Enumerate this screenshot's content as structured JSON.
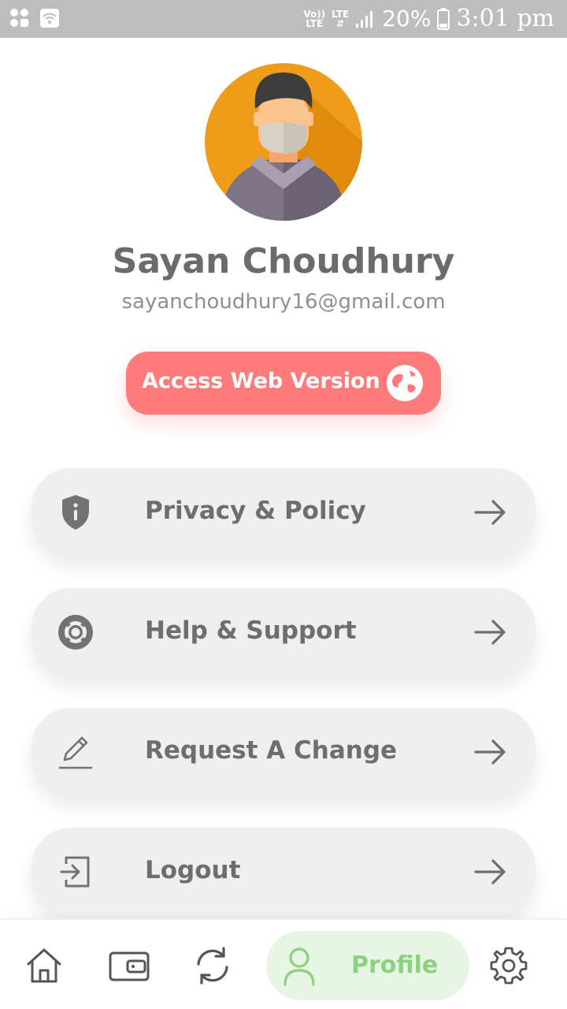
{
  "status_bar": {
    "volte": "Vo))",
    "volte_sub": "LTE",
    "lte": "LTE",
    "battery": "20%",
    "time": "3:01 pm"
  },
  "profile": {
    "name": "Sayan Choudhury",
    "email": "sayanchoudhury16@gmail.com"
  },
  "web_button": {
    "label": "Access Web Version",
    "icon": "globe-icon"
  },
  "menu": [
    {
      "label": "Privacy & Policy",
      "icon": "shield-info-icon"
    },
    {
      "label": "Help & Support",
      "icon": "lifebuoy-icon"
    },
    {
      "label": "Request A Change",
      "icon": "pencil-icon"
    },
    {
      "label": "Logout",
      "icon": "logout-icon"
    }
  ],
  "bottom_nav": {
    "items": [
      "home-icon",
      "wallet-icon",
      "refresh-icon",
      "profile-icon",
      "settings-icon"
    ],
    "active_label": "Profile"
  },
  "colors": {
    "accent": "#ff7b7b",
    "active_nav_bg": "#e7f6e4",
    "active_nav_fg": "#8bd17f",
    "card_bg": "#efefef"
  }
}
